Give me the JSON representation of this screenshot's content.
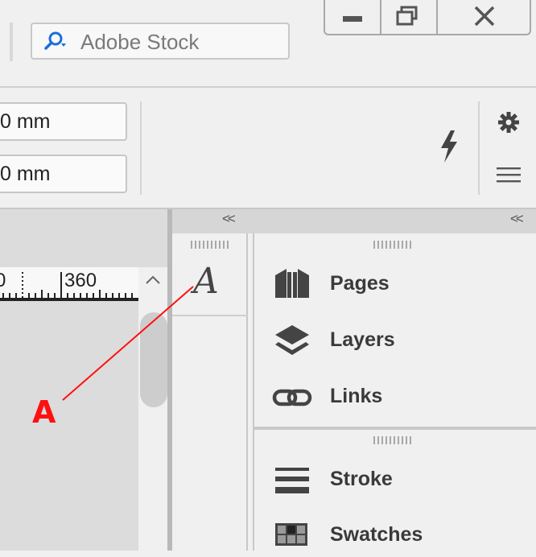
{
  "titlebar": {
    "search_placeholder": "Adobe Stock"
  },
  "controls": {
    "field_top_value": "0 mm",
    "field_bottom_value": "0 mm"
  },
  "ruler": {
    "tick_left_label": "0",
    "tick_360_label": "360"
  },
  "panels": {
    "collapse_left": "<<",
    "collapse_right": "<<",
    "character_glyph": "A",
    "items_group1": [
      {
        "label": "Pages",
        "icon": "pages-icon"
      },
      {
        "label": "Layers",
        "icon": "layers-icon"
      },
      {
        "label": "Links",
        "icon": "links-icon"
      }
    ],
    "items_group2": [
      {
        "label": "Stroke",
        "icon": "stroke-icon"
      },
      {
        "label": "Swatches",
        "icon": "swatches-icon"
      }
    ]
  },
  "annotation": {
    "label": "A",
    "color": "#ff1010"
  }
}
